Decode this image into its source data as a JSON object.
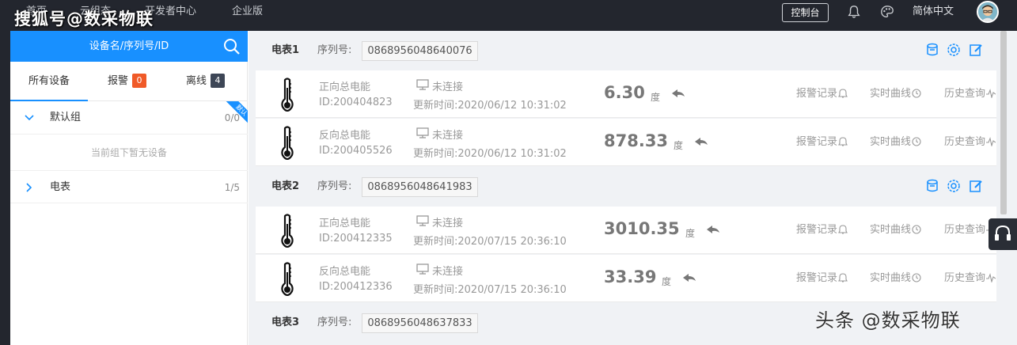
{
  "watermark_top": "搜狐号@数采物联",
  "watermark_bottom": "头条 @数采物联",
  "top_nav": {
    "items": [
      "首页",
      "云组态",
      "开发者中心",
      "企业版"
    ],
    "console_label": "控制台",
    "language": "简体中文",
    "icons": [
      "bell-icon",
      "palette-icon"
    ]
  },
  "sidebar": {
    "search_label": "设备名/序列号/ID",
    "tabs": [
      {
        "label": "所有设备"
      },
      {
        "label": "报警",
        "count": "0"
      },
      {
        "label": "离线",
        "count": "4"
      }
    ],
    "groups": [
      {
        "name": "默认组",
        "count": "0/0",
        "ribbon": "默认"
      },
      {
        "name": "电表",
        "count": "1/5"
      }
    ],
    "empty_hint": "当前组下暂无设备"
  },
  "meters": [
    {
      "name": "电表1",
      "serial_label": "序列号:",
      "serial": "0868956048640076",
      "devices": [
        {
          "name": "正向总电能",
          "id": "ID:200404823",
          "status": "未连接",
          "updated": "更新时间:2020/06/12 10:31:02",
          "value": "6.30",
          "unit": "度"
        },
        {
          "name": "反向总电能",
          "id": "ID:200405526",
          "status": "未连接",
          "updated": "更新时间:2020/06/12 10:31:02",
          "value": "878.33",
          "unit": "度"
        }
      ]
    },
    {
      "name": "电表2",
      "serial_label": "序列号:",
      "serial": "0868956048641983",
      "devices": [
        {
          "name": "正向总电能",
          "id": "ID:200412335",
          "status": "未连接",
          "updated": "更新时间:2020/07/15 20:36:10",
          "value": "3010.35",
          "unit": "度"
        },
        {
          "name": "反向总电能",
          "id": "ID:200412336",
          "status": "未连接",
          "updated": "更新时间:2020/07/15 20:36:10",
          "value": "33.39",
          "unit": "度"
        }
      ]
    },
    {
      "name": "电表3",
      "serial_label": "序列号:",
      "serial": "0868956048637833",
      "devices": []
    }
  ],
  "row_actions": {
    "alarm": "报警记录",
    "realtime": "实时曲线",
    "history": "历史查询"
  },
  "colors": {
    "accent": "#1890ff",
    "alarm_badge": "#f05a28",
    "offline_badge": "#3d4656",
    "topbar": "#23262e"
  }
}
